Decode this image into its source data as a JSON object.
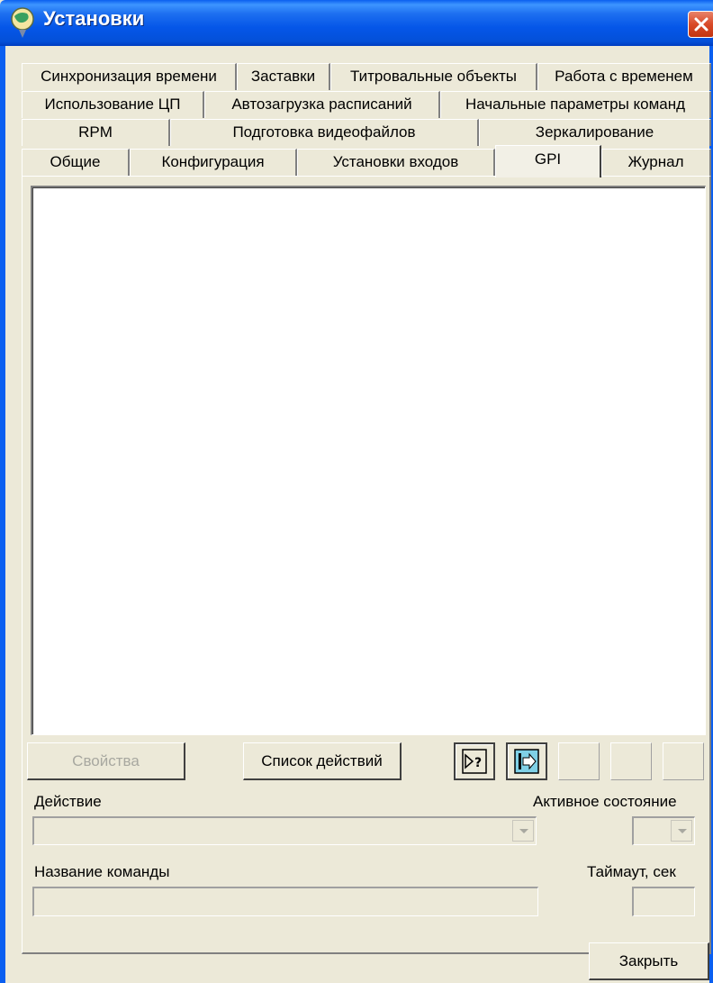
{
  "window": {
    "title": "Установки"
  },
  "tabs": {
    "row1": [
      "Синхронизация времени",
      "Заставки",
      "Титровальные объекты",
      "Работа с временем"
    ],
    "row2": [
      "Использование ЦП",
      "Автозагрузка расписаний",
      "Начальные параметры команд"
    ],
    "row3": [
      "RPM",
      "Подготовка видеофайлов",
      "Зеркалирование"
    ],
    "row4": [
      "Общие",
      "Конфигурация",
      "Установки входов",
      "GPI",
      "Журнал"
    ],
    "active": "GPI"
  },
  "buttons": {
    "properties": "Свойства",
    "action_list": "Список действий",
    "close": "Закрыть"
  },
  "form": {
    "action_label": "Действие",
    "action_value": "",
    "active_state_label": "Активное состояние",
    "active_state_value": "",
    "command_name_label": "Название команды",
    "command_name_value": "",
    "timeout_label": "Таймаут, сек",
    "timeout_value": ""
  },
  "icons": {
    "help_pointer": "help-pointer-icon",
    "import_arrow": "import-arrow-icon"
  },
  "colors": {
    "titlebar": "#0556e8",
    "face": "#ece9d8",
    "close": "#d94a28"
  }
}
